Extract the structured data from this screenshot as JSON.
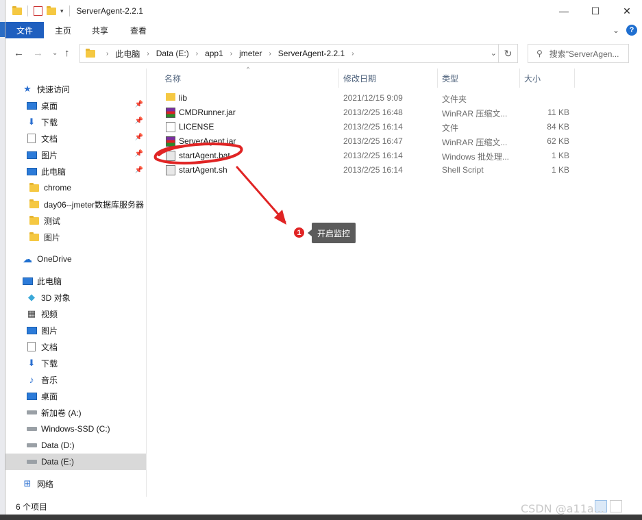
{
  "window": {
    "title": "ServerAgent-2.2.1",
    "controls": {
      "minimize": "—",
      "maximize": "☐",
      "close": "✕"
    }
  },
  "ribbon": {
    "tabs": [
      "文件",
      "主页",
      "共享",
      "查看"
    ]
  },
  "address": {
    "crumbs": [
      "此电脑",
      "Data (E:)",
      "app1",
      "jmeter",
      "ServerAgent-2.2.1"
    ],
    "search_placeholder": "搜索\"ServerAgen..."
  },
  "nav": {
    "items": [
      {
        "label": "快速访问",
        "icon": "star-icon",
        "pinned": false
      },
      {
        "label": "桌面",
        "icon": "desktop-icon",
        "pinned": true
      },
      {
        "label": "下载",
        "icon": "download-icon",
        "pinned": true
      },
      {
        "label": "文档",
        "icon": "document-icon",
        "pinned": true
      },
      {
        "label": "图片",
        "icon": "pictures-icon",
        "pinned": true
      },
      {
        "label": "此电脑",
        "icon": "computer-icon",
        "pinned": true
      },
      {
        "label": "chrome",
        "icon": "folder-icon",
        "pinned": false
      },
      {
        "label": "day06--jmeter数据库服务器",
        "icon": "folder-icon",
        "pinned": false
      },
      {
        "label": "测试",
        "icon": "folder-icon",
        "pinned": false
      },
      {
        "label": "图片",
        "icon": "folder-icon",
        "pinned": false
      },
      {
        "label": "OneDrive",
        "icon": "cloud-icon",
        "pinned": false
      },
      {
        "label": "此电脑",
        "icon": "computer-icon",
        "pinned": false
      },
      {
        "label": "3D 对象",
        "icon": "cube-icon",
        "pinned": false
      },
      {
        "label": "视频",
        "icon": "video-icon",
        "pinned": false
      },
      {
        "label": "图片",
        "icon": "pictures-icon",
        "pinned": false
      },
      {
        "label": "文档",
        "icon": "document-icon",
        "pinned": false
      },
      {
        "label": "下载",
        "icon": "download-icon",
        "pinned": false
      },
      {
        "label": "音乐",
        "icon": "music-icon",
        "pinned": false
      },
      {
        "label": "桌面",
        "icon": "desktop-icon",
        "pinned": false
      },
      {
        "label": "新加卷 (A:)",
        "icon": "drive-icon",
        "pinned": false
      },
      {
        "label": "Windows-SSD (C:)",
        "icon": "drive-icon",
        "pinned": false
      },
      {
        "label": "Data (D:)",
        "icon": "drive-icon",
        "pinned": false
      },
      {
        "label": "Data (E:)",
        "icon": "drive-icon",
        "pinned": false,
        "selected": true
      },
      {
        "label": "网络",
        "icon": "network-icon",
        "pinned": false
      }
    ]
  },
  "columns": {
    "name": "名称",
    "date": "修改日期",
    "type": "类型",
    "size": "大小"
  },
  "files": [
    {
      "name": "lib",
      "date": "2021/12/15 9:09",
      "type": "文件夹",
      "size": "",
      "icon": "folder"
    },
    {
      "name": "CMDRunner.jar",
      "date": "2013/2/25 16:48",
      "type": "WinRAR 压缩文...",
      "size": "11 KB",
      "icon": "rar"
    },
    {
      "name": "LICENSE",
      "date": "2013/2/25 16:14",
      "type": "文件",
      "size": "84 KB",
      "icon": "file"
    },
    {
      "name": "ServerAgent.jar",
      "date": "2013/2/25 16:47",
      "type": "WinRAR 压缩文...",
      "size": "62 KB",
      "icon": "rar"
    },
    {
      "name": "startAgent.bat",
      "date": "2013/2/25 16:14",
      "type": "Windows 批处理...",
      "size": "1 KB",
      "icon": "bat"
    },
    {
      "name": "startAgent.sh",
      "date": "2013/2/25 16:14",
      "type": "Shell Script",
      "size": "1 KB",
      "icon": "bat"
    }
  ],
  "status": {
    "count": "6 个项目"
  },
  "annotation": {
    "badge": "1",
    "text": "开启监控",
    "color": "#e02424"
  },
  "watermark": "CSDN @a11a..."
}
